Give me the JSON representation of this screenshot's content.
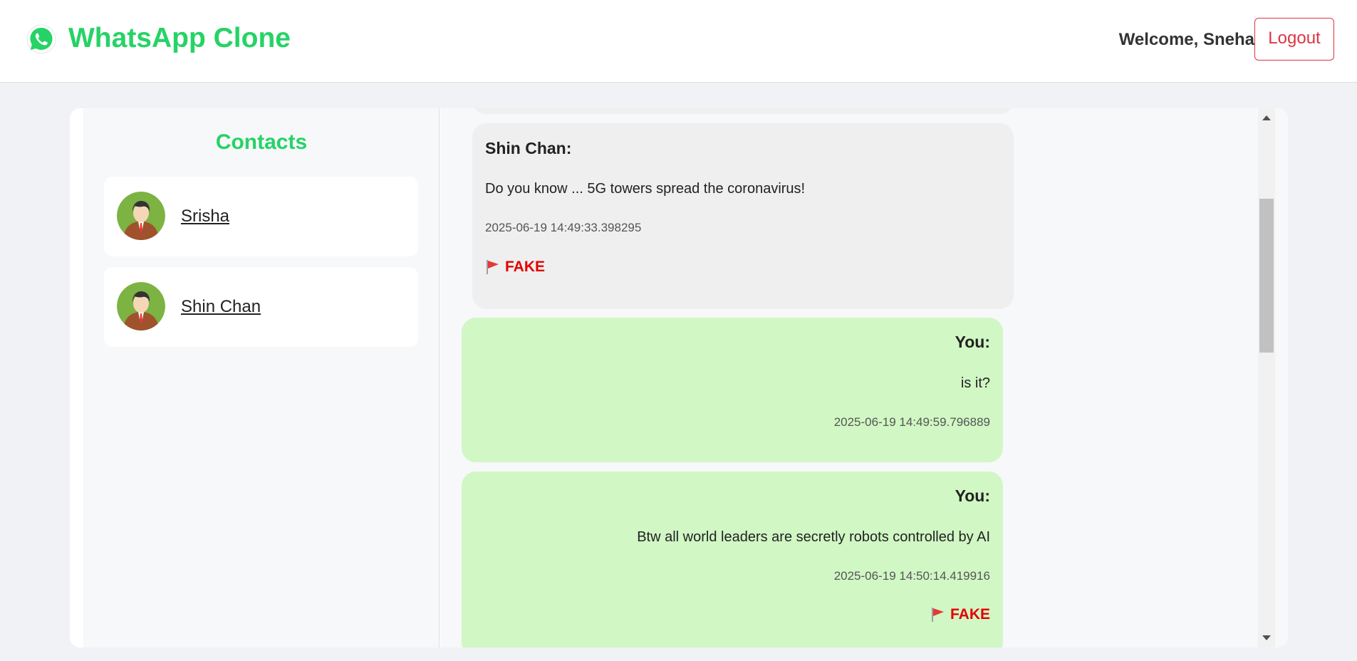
{
  "header": {
    "app_title": "WhatsApp Clone",
    "welcome_text": "Welcome, Sneha",
    "logout_label": "Logout",
    "brand_color": "#25d366",
    "logo_icon": "whatsapp-icon"
  },
  "sidebar": {
    "title": "Contacts",
    "contacts": [
      {
        "name": "Srisha",
        "avatar_icon": "user-avatar-icon"
      },
      {
        "name": "Shin Chan",
        "avatar_icon": "user-avatar-icon"
      }
    ]
  },
  "chat": {
    "messages": [
      {
        "direction": "received",
        "sender": "Shin Chan:",
        "text": "Do you know ... 5G towers spread the coronavirus!",
        "timestamp": "2025-06-19 14:49:33.398295",
        "flag": "FAKE",
        "flag_icon": "red-flag-icon"
      },
      {
        "direction": "sent",
        "sender": "You:",
        "text": "is it?",
        "timestamp": "2025-06-19 14:49:59.796889"
      },
      {
        "direction": "sent",
        "sender": "You:",
        "text": "Btw all world leaders are secretly robots controlled by AI",
        "timestamp": "2025-06-19 14:50:14.419916",
        "flag": "FAKE",
        "flag_icon": "red-flag-icon"
      }
    ],
    "received_bubble_color": "#efefef",
    "sent_bubble_color": "#d1f7c4",
    "fake_flag_color": "#e30000"
  },
  "colors": {
    "logout": "#dc3545",
    "page_background": "#f0f2f5"
  }
}
